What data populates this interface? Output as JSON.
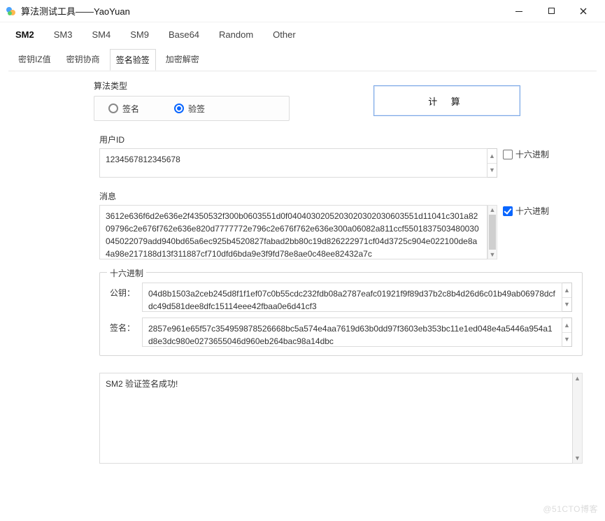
{
  "window": {
    "title": "算法测试工具——YaoYuan"
  },
  "topTabs": [
    "SM2",
    "SM3",
    "SM4",
    "SM9",
    "Base64",
    "Random",
    "Other"
  ],
  "subTabs": [
    "密钥IZ值",
    "密钥协商",
    "签名验签",
    "加密解密"
  ],
  "algorithm": {
    "label": "算法类型",
    "sign": "签名",
    "verify": "验签"
  },
  "calcLabel": "计 算",
  "userId": {
    "label": "用户ID",
    "value": "1234567812345678",
    "hexLabel": "十六进制"
  },
  "message": {
    "label": "消息",
    "value": "3612e636f6d2e636e2f4350532f300b0603551d0f0404030205203020302030603551d11041c301a8209796c2e676f762e636e820d7777772e796c2e676f762e636e300a06082a811ccf5501837503480030045022079add940bd65a6ec925b4520827fabad2bb80c19d826222971cf04d3725c904e022100de8a4a98e217188d13f311887cf710dfd6bda9e3f9fd78e8ae0c48ee82432a7c",
    "hexLabel": "十六进制"
  },
  "hexGroup": {
    "legend": "十六进制",
    "pubKeyLabel": "公钥：",
    "pubKey": "04d8b1503a2ceb245d8f1f1ef07c0b55cdc232fdb08a2787eafc01921f9f89d37b2c8b4d26d6c01b49ab06978dcfdc49d581dee8dfc15114eee42fbaa0e6d41cf3",
    "sigLabel": "签名：",
    "sig": "2857e961e65f57c354959878526668bc5a574e4aa7619d63b0dd97f3603eb353bc11e1ed048e4a5446a954a1d8e3dc980e0273655046d960eb264bac98a14dbc"
  },
  "result": "SM2 验证签名成功!",
  "watermark": "@51CTO博客"
}
